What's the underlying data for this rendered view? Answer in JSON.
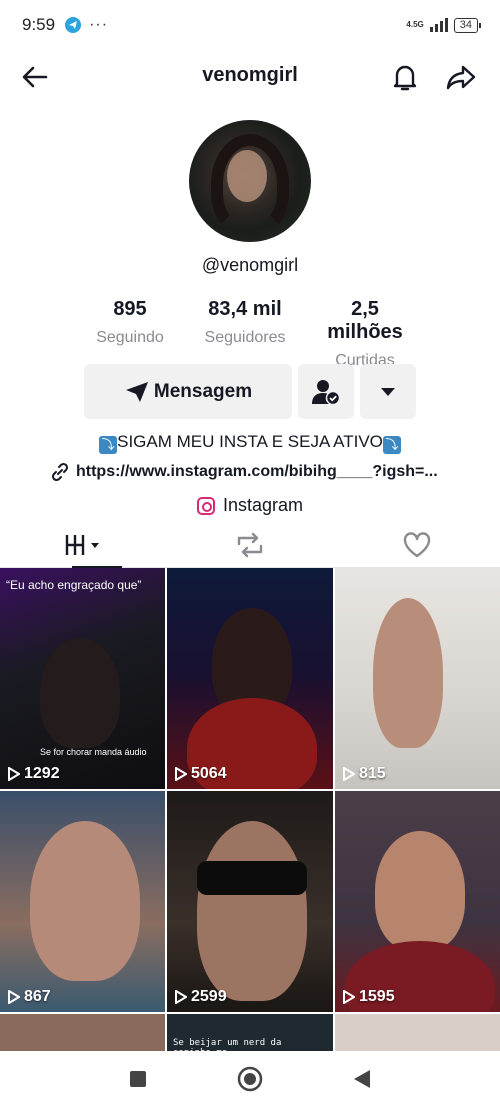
{
  "status_bar": {
    "time": "9:59",
    "network": "4.5G",
    "battery": "34"
  },
  "header": {
    "title": "venomgirl"
  },
  "profile": {
    "handle": "@venomgirl",
    "stats": [
      {
        "value": "895",
        "label": "Seguindo"
      },
      {
        "value": "83,4 mil",
        "label": "Seguidores"
      },
      {
        "value": "2,5 milhões",
        "label": "Curtidas"
      }
    ],
    "message_label": "Mensagem",
    "bio": "SIGAM MEU INSTA E SEJA ATIVO",
    "bio_emoji": "⤵",
    "link": "https://www.instagram.com/bibihg____?igsh=...",
    "instagram_label": "Instagram"
  },
  "tabs": [
    "videos",
    "reposts",
    "liked"
  ],
  "videos": [
    {
      "views": "1292",
      "caption_top": "“Eu acho engraçado que”",
      "caption_bottom": "Se for chorar manda áudio"
    },
    {
      "views": "5064"
    },
    {
      "views": "815"
    },
    {
      "views": "867"
    },
    {
      "views": "2599"
    },
    {
      "views": "1595"
    },
    {
      "views": ""
    },
    {
      "views": "",
      "caption_top": "Se beijar um nerd da sapinho.me"
    },
    {
      "views": ""
    }
  ],
  "colors": {
    "text_primary": "#161823",
    "text_secondary": "#8a8b91",
    "button_bg": "#f1f1f2",
    "instagram": "#d62976"
  }
}
